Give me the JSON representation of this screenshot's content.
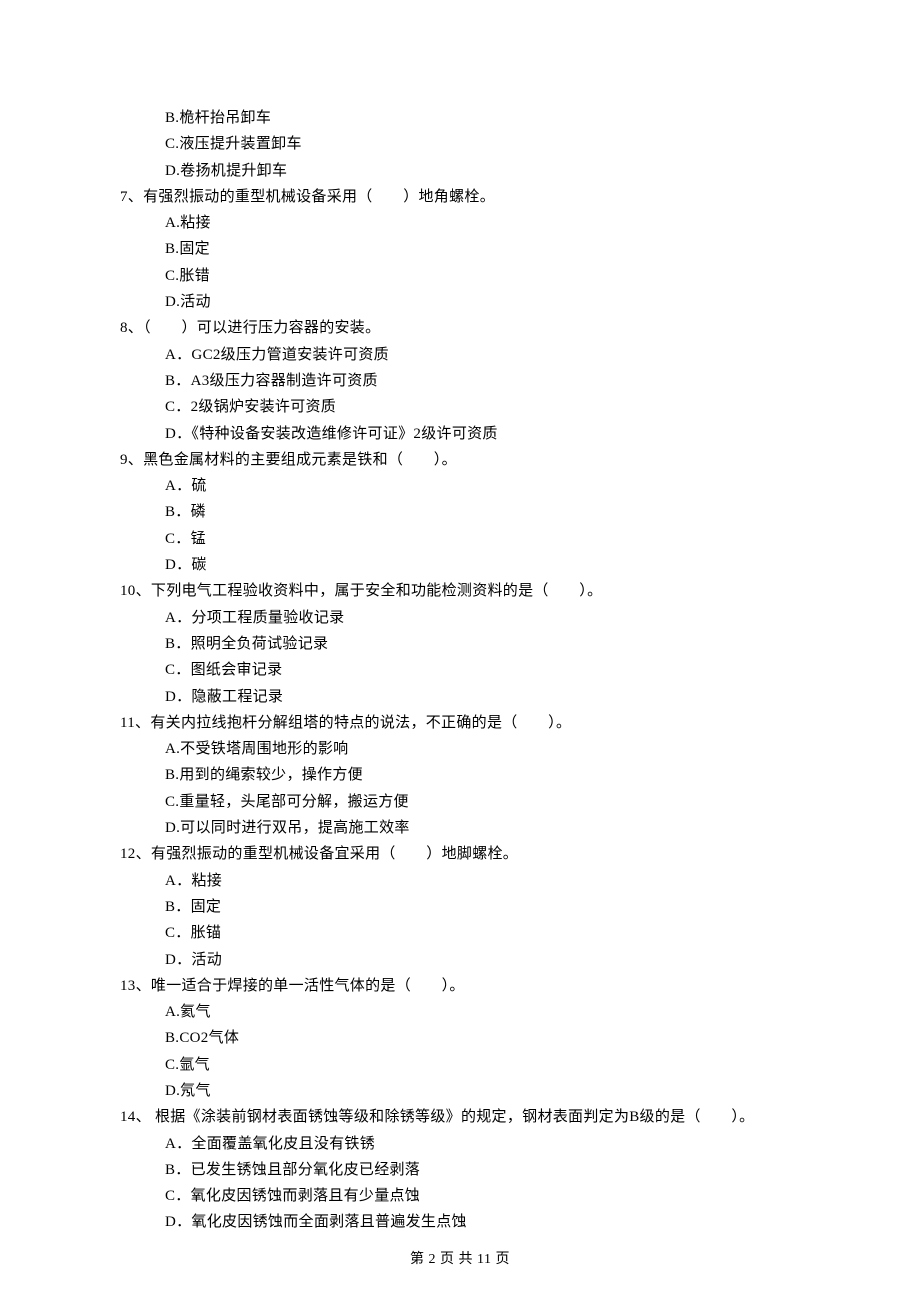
{
  "intro_options": [
    "B.桅杆抬吊卸车",
    "C.液压提升装置卸车",
    "D.卷扬机提升卸车"
  ],
  "questions": [
    {
      "stem": "7、有强烈振动的重型机械设备采用（　　）地角螺栓。",
      "options": [
        "A.粘接",
        "B.固定",
        "C.胀错",
        "D.活动"
      ]
    },
    {
      "stem": "8、（　　）可以进行压力容器的安装。",
      "options": [
        "A．GC2级压力管道安装许可资质",
        "B．A3级压力容器制造许可资质",
        "C．2级锅炉安装许可资质",
        "D．《特种设备安装改造维修许可证》2级许可资质"
      ]
    },
    {
      "stem": "9、黑色金属材料的主要组成元素是铁和（　　）。",
      "options": [
        "A．硫",
        "B．磷",
        "C．锰",
        "D．碳"
      ]
    },
    {
      "stem": "10、下列电气工程验收资料中，属于安全和功能检测资料的是（　　）。",
      "options": [
        "A．分项工程质量验收记录",
        "B．照明全负荷试验记录",
        "C．图纸会审记录",
        "D．隐蔽工程记录"
      ]
    },
    {
      "stem": "11、有关内拉线抱杆分解组塔的特点的说法，不正确的是（　　）。",
      "options": [
        "A.不受铁塔周围地形的影响",
        "B.用到的绳索较少，操作方便",
        "C.重量轻，头尾部可分解，搬运方便",
        "D.可以同时进行双吊，提高施工效率"
      ]
    },
    {
      "stem": "12、有强烈振动的重型机械设备宜采用（　　）地脚螺栓。",
      "options": [
        "A．粘接",
        "B．固定",
        "C．胀锚",
        "D．活动"
      ]
    },
    {
      "stem": "13、唯一适合于焊接的单一活性气体的是（　　）。",
      "options": [
        "A.氦气",
        "B.CO2气体",
        "C.氩气",
        "D.氖气"
      ]
    },
    {
      "stem": "14、 根据《涂装前钢材表面锈蚀等级和除锈等级》的规定，钢材表面判定为B级的是（　　）。",
      "options": [
        "A．全面覆盖氧化皮且没有铁锈",
        "B．已发生锈蚀且部分氧化皮已经剥落",
        "C．氧化皮因锈蚀而剥落且有少量点蚀",
        "D．氧化皮因锈蚀而全面剥落且普遍发生点蚀"
      ]
    }
  ],
  "footer": "第 2 页 共 11 页"
}
